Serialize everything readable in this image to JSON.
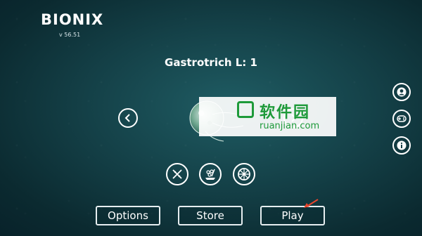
{
  "app": {
    "title": "BIONIX",
    "version": "v 56.51"
  },
  "creature": {
    "name": "Gastrotrich L: 1"
  },
  "watermark": {
    "cn": "软件园",
    "en": "ruanjian.com"
  },
  "nav": {
    "prev_icon": "chevron-left-icon",
    "next_icon": "chevron-right-icon"
  },
  "actions": [
    {
      "icon": "dna-icon"
    },
    {
      "icon": "microbe-dish-icon"
    },
    {
      "icon": "wheel-icon"
    }
  ],
  "side": [
    {
      "icon": "account-icon"
    },
    {
      "icon": "gamepad-icon"
    },
    {
      "icon": "info-icon"
    }
  ],
  "menu": {
    "options": "Options",
    "store": "Store",
    "play": "Play"
  },
  "colors": {
    "accent_arrow": "#e8452c",
    "watermark_green": "#1e9a3a"
  }
}
